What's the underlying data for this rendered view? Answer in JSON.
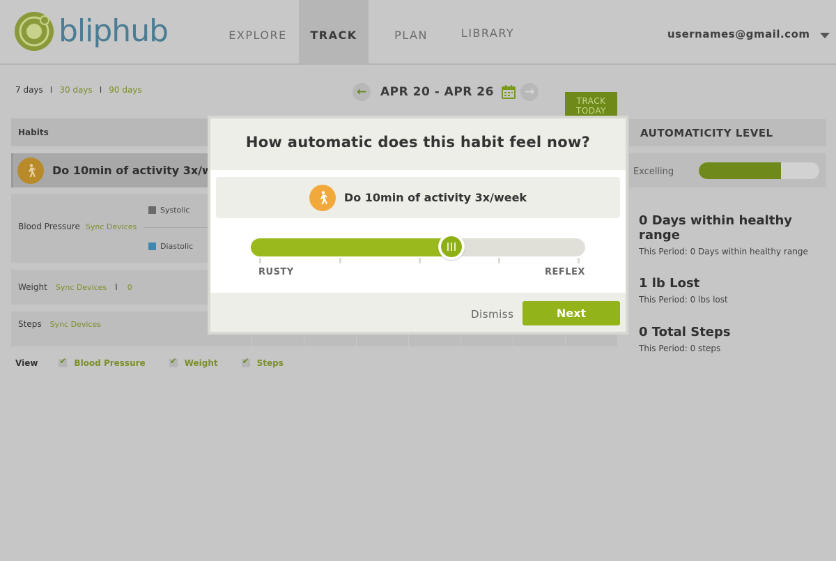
{
  "header": {
    "logo_text": "bliphub",
    "nav": [
      {
        "label": "EXPLORE"
      },
      {
        "label": "TRACK"
      },
      {
        "label": "PLAN"
      },
      {
        "label": "LIBRARY"
      }
    ],
    "active_nav": "TRACK",
    "user_email": "usernames@gmail.com"
  },
  "periods": {
    "items": [
      "7 days",
      "30 days",
      "90 days"
    ],
    "separator": "I",
    "active": "7 days"
  },
  "date_nav": {
    "range": "APR 20 - APR 26",
    "prev_icon": "arrow-left-icon",
    "next_icon": "arrow-right-icon",
    "calendar_icon": "calendar-icon"
  },
  "track_today": {
    "line1": "TRACK",
    "line2": "TODAY"
  },
  "habits": {
    "header": "Habits",
    "items": [
      {
        "name": "Do 10min of activity 3x/week",
        "icon": "walking-person-icon"
      }
    ]
  },
  "metrics": {
    "blood_pressure": {
      "label": "Blood Pressure",
      "sync": "Sync Devices",
      "legend": [
        {
          "name": "Systolic",
          "color": "#6a6a6a"
        },
        {
          "name": "Diastolic",
          "color": "#3f86b1"
        }
      ]
    },
    "weight": {
      "label": "Weight",
      "sync": "Sync Devices",
      "separator": "I",
      "value": "0"
    },
    "steps": {
      "label": "Steps",
      "sync": "Sync Devices"
    }
  },
  "view": {
    "label": "View",
    "options": [
      {
        "label": "Blood Pressure",
        "checked": true
      },
      {
        "label": "Weight",
        "checked": true
      },
      {
        "label": "Steps",
        "checked": true
      }
    ]
  },
  "automaticity": {
    "header": "AUTOMATICITY LEVEL",
    "level_label": "Excelling",
    "level_fraction": 0.68,
    "fill_color": "#6f8a1b"
  },
  "stats": [
    {
      "title": "0 Days within healthy range",
      "sub": "This Period: 0 Days within healthy range"
    },
    {
      "title": "1 lb Lost",
      "sub": "This Period: 0 lbs lost"
    },
    {
      "title": "0 Total Steps",
      "sub": "This Period: 0 steps"
    }
  ],
  "modal": {
    "question": "How automatic does this habit feel now?",
    "habit_name": "Do 10min of activity 3x/week",
    "habit_icon": "walking-person-icon",
    "slider_value": 0.6,
    "scale_min_label": "RUSTY",
    "scale_max_label": "REFLEX",
    "dismiss_label": "Dismiss",
    "next_label": "Next",
    "accent_color": "#92b319"
  }
}
